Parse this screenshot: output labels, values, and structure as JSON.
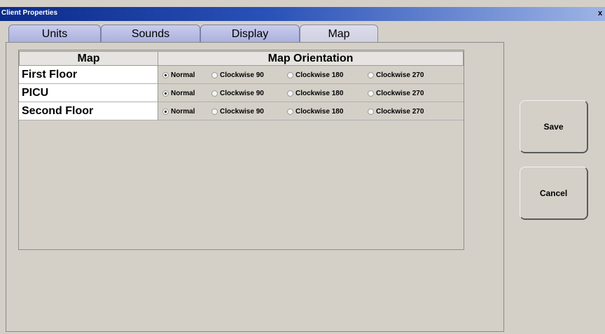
{
  "window": {
    "title": "Client Properties",
    "close_glyph": "x"
  },
  "tabs": [
    {
      "label": "Units",
      "active": false
    },
    {
      "label": "Sounds",
      "active": false
    },
    {
      "label": "Display",
      "active": false
    },
    {
      "label": "Map",
      "active": true
    }
  ],
  "table": {
    "headers": {
      "map": "Map",
      "orientation": "Map Orientation"
    },
    "rows": [
      {
        "map": "First Floor",
        "options": [
          {
            "label": "Normal",
            "selected": true
          },
          {
            "label": "Clockwise 90",
            "selected": false
          },
          {
            "label": "Clockwise 180",
            "selected": false
          },
          {
            "label": "Clockwise 270",
            "selected": false
          }
        ]
      },
      {
        "map": "PICU",
        "options": [
          {
            "label": "Normal",
            "selected": true
          },
          {
            "label": "Clockwise 90",
            "selected": false
          },
          {
            "label": "Clockwise 180",
            "selected": false
          },
          {
            "label": "Clockwise 270",
            "selected": false
          }
        ]
      },
      {
        "map": "Second Floor",
        "options": [
          {
            "label": "Normal",
            "selected": true
          },
          {
            "label": "Clockwise 90",
            "selected": false
          },
          {
            "label": "Clockwise 180",
            "selected": false
          },
          {
            "label": "Clockwise 270",
            "selected": false
          }
        ]
      }
    ]
  },
  "buttons": {
    "save": "Save",
    "cancel": "Cancel"
  },
  "icons": {
    "close": "close-icon",
    "radio_checked": "radio-selected",
    "radio_unchecked": "radio-unselected"
  }
}
